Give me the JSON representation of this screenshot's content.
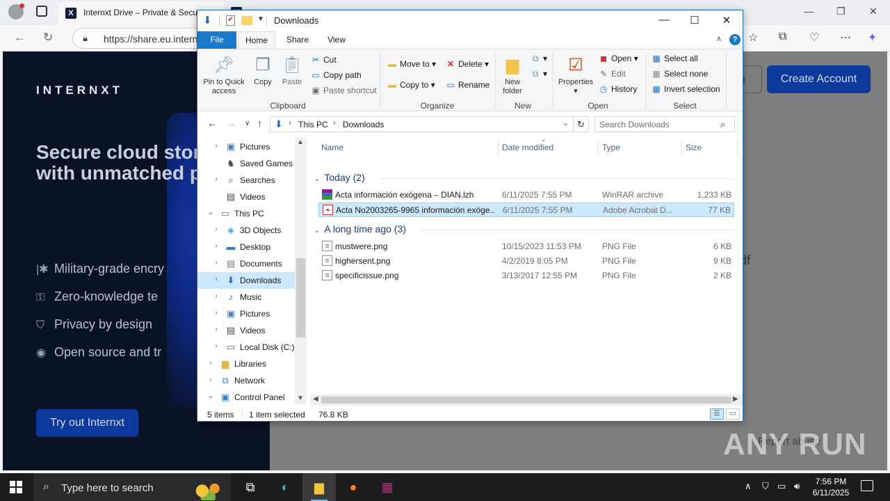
{
  "browser": {
    "tab_title": "Internxt Drive – Private & Secure",
    "tab_favicon": "X",
    "address_url": "https://share.eu.intern",
    "page": {
      "logo": "INTERNXT",
      "hero_title": "Secure cloud storage with unmatched p",
      "features": [
        {
          "icon": "asterisk-icon",
          "text": "Military-grade encry"
        },
        {
          "icon": "key-icon",
          "text": "Zero-knowledge te"
        },
        {
          "icon": "shield-check-icon",
          "text": "Privacy by design"
        },
        {
          "icon": "eye-icon",
          "text": "Open source and tr"
        }
      ],
      "try_button": "Try out Internxt",
      "create_account": "Create Account",
      "login_fragment": "n",
      "file_fragment": "df",
      "report_fragment": "Report abuse",
      "watermark": "ANY RUN"
    }
  },
  "explorer": {
    "title": "Downloads",
    "ribbon_tabs": [
      "File",
      "Home",
      "Share",
      "View"
    ],
    "clipboard": {
      "label": "Clipboard",
      "pin": "Pin to Quick access",
      "copy": "Copy",
      "paste": "Paste",
      "cut": "Cut",
      "copy_path": "Copy path",
      "paste_shortcut": "Paste shortcut"
    },
    "organize": {
      "label": "Organize",
      "move_to": "Move to",
      "copy_to": "Copy to",
      "delete": "Delete",
      "rename": "Rename"
    },
    "new": {
      "label": "New",
      "new_folder": "New folder"
    },
    "open": {
      "label": "Open",
      "properties": "Properties",
      "open": "Open",
      "edit": "Edit",
      "history": "History"
    },
    "select": {
      "label": "Select",
      "select_all": "Select all",
      "select_none": "Select none",
      "invert": "Invert selection"
    },
    "path": [
      "This PC",
      "Downloads"
    ],
    "search_placeholder": "Search Downloads",
    "nav_items": [
      {
        "label": "Pictures",
        "icon": "pictures-icon",
        "indent": 2,
        "expander": true
      },
      {
        "label": "Saved Games",
        "icon": "saved-games-icon",
        "indent": 2,
        "expander": false
      },
      {
        "label": "Searches",
        "icon": "searches-icon",
        "indent": 2,
        "expander": true
      },
      {
        "label": "Videos",
        "icon": "videos-icon",
        "indent": 2,
        "expander": false
      },
      {
        "label": "This PC",
        "icon": "this-pc-icon",
        "indent": 1,
        "expander": true,
        "expanded": true
      },
      {
        "label": "3D Objects",
        "icon": "3d-objects-icon",
        "indent": 2,
        "expander": true
      },
      {
        "label": "Desktop",
        "icon": "desktop-icon",
        "indent": 2,
        "expander": true
      },
      {
        "label": "Documents",
        "icon": "documents-icon",
        "indent": 2,
        "expander": true
      },
      {
        "label": "Downloads",
        "icon": "downloads-icon",
        "indent": 2,
        "expander": true,
        "selected": true
      },
      {
        "label": "Music",
        "icon": "music-icon",
        "indent": 2,
        "expander": true
      },
      {
        "label": "Pictures",
        "icon": "pictures-icon",
        "indent": 2,
        "expander": true
      },
      {
        "label": "Videos",
        "icon": "videos-icon",
        "indent": 2,
        "expander": true
      },
      {
        "label": "Local Disk (C:)",
        "icon": "drive-icon",
        "indent": 2,
        "expander": true
      },
      {
        "label": "Libraries",
        "icon": "libraries-icon",
        "indent": 1,
        "expander": true
      },
      {
        "label": "Network",
        "icon": "network-icon",
        "indent": 1,
        "expander": true
      },
      {
        "label": "Control Panel",
        "icon": "control-panel-icon",
        "indent": 1,
        "expander": true,
        "expanded": true
      }
    ],
    "columns": [
      "Name",
      "Date modified",
      "Type",
      "Size"
    ],
    "groups": [
      {
        "title": "Today (2)",
        "files": [
          {
            "name": "Acta información exógena – DIAN.lzh",
            "date": "6/11/2025 7:55 PM",
            "type": "WinRAR archive",
            "size": "1,233 KB",
            "icon": "rar"
          },
          {
            "name": "Acta No2003265-9965 información exóge...",
            "date": "6/11/2025 7:55 PM",
            "type": "Adobe Acrobat D...",
            "size": "77 KB",
            "icon": "pdf",
            "selected": true
          }
        ]
      },
      {
        "title": "A long time ago (3)",
        "files": [
          {
            "name": "mustwere.png",
            "date": "10/15/2023 11:53 PM",
            "type": "PNG File",
            "size": "6 KB",
            "icon": "png"
          },
          {
            "name": "highersent.png",
            "date": "4/2/2019 8:05 PM",
            "type": "PNG File",
            "size": "9 KB",
            "icon": "png"
          },
          {
            "name": "specificissue.png",
            "date": "3/13/2017 12:55 PM",
            "type": "PNG File",
            "size": "2 KB",
            "icon": "png"
          }
        ]
      }
    ],
    "status": {
      "count": "5 items",
      "selected": "1 item selected",
      "size": "76.8 KB"
    }
  },
  "taskbar": {
    "search_text": "Type here to search",
    "time": "7:56 PM",
    "date": "6/11/2025"
  },
  "colors": {
    "accent": "#1979ca",
    "selection": "#cce8ff",
    "hero_bg": "#0a1225",
    "cta": "#0b3a9c"
  }
}
